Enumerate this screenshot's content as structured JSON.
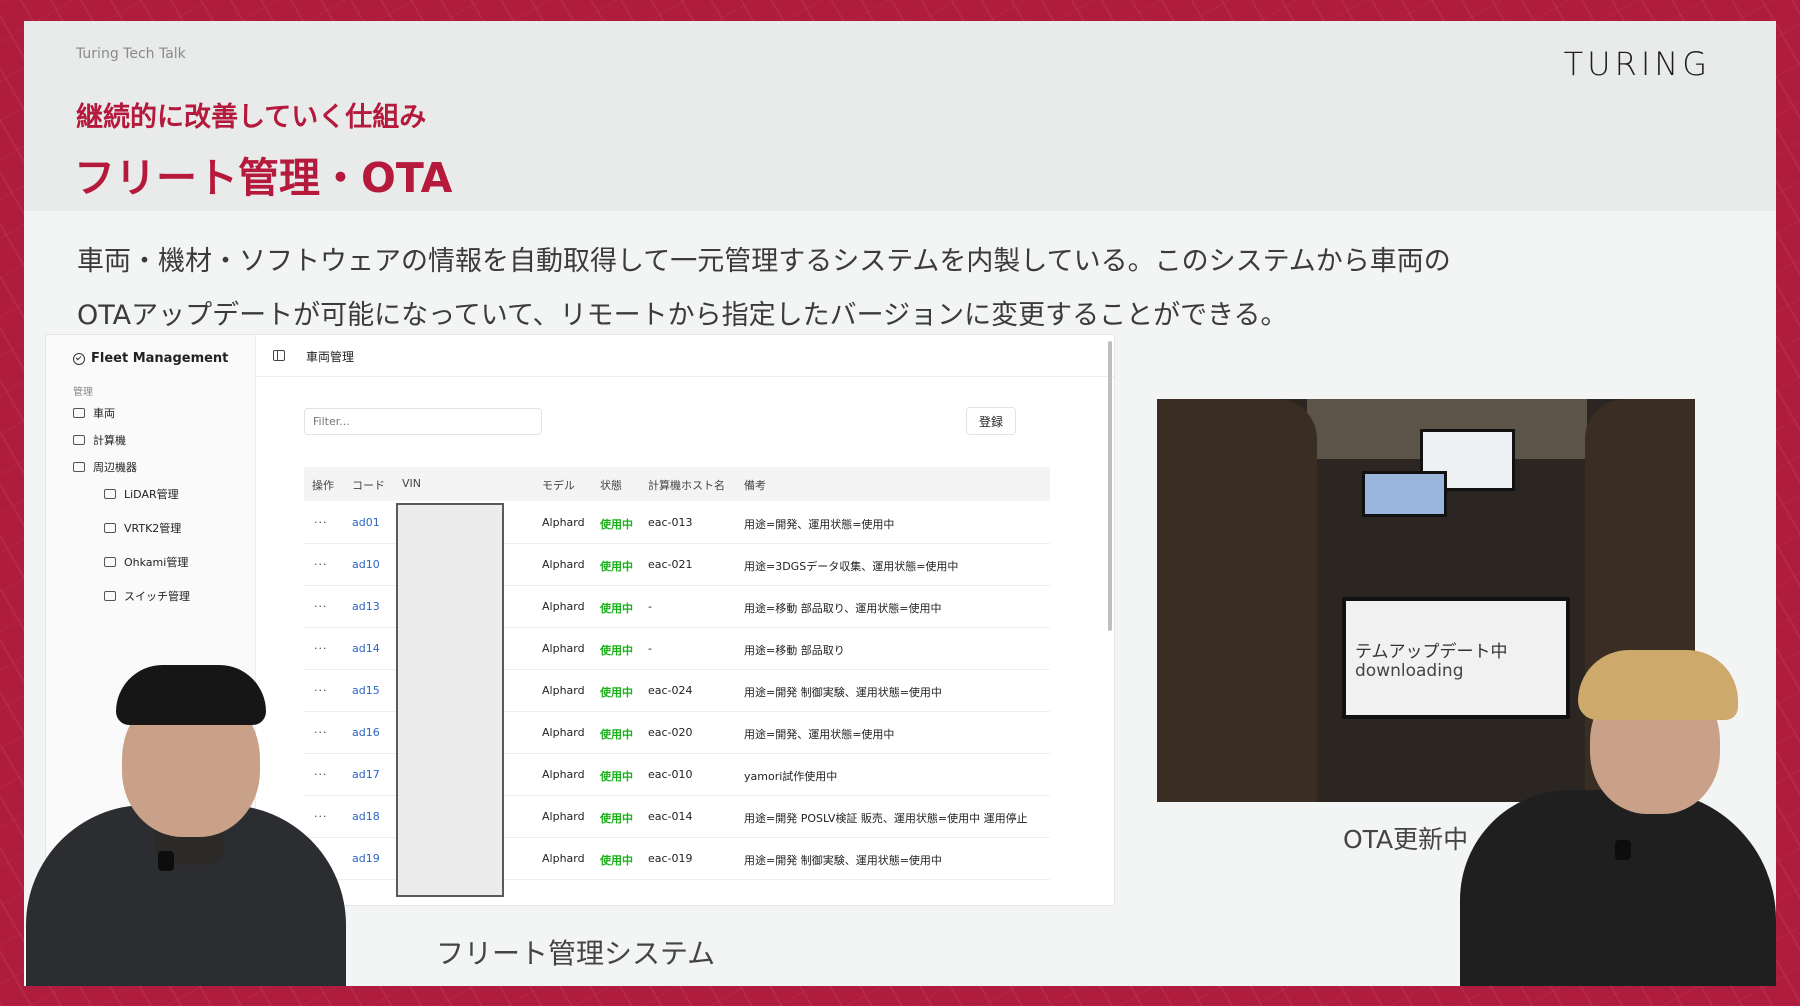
{
  "slide": {
    "event_name": "Turing Tech Talk",
    "logo": "TURING",
    "subtitle": "継続的に改善していく仕組み",
    "title": "フリート管理・OTA",
    "description_line1": "車両・機材・ソフトウェアの情報を自動取得して一元管理するシステムを内製している。このシステムから車両の",
    "description_line2": "OTAアップデートが可能になっていて、リモートから指定したバージョンに変更することができる。"
  },
  "fleet_app": {
    "brand": "Fleet Management",
    "group_label": "管理",
    "nav": [
      {
        "label": "車両",
        "icon": "car-icon"
      },
      {
        "label": "計算機",
        "icon": "server-icon"
      },
      {
        "label": "周辺機器",
        "icon": "devices-icon"
      },
      {
        "label": "LiDAR管理",
        "icon": "lidar-icon"
      },
      {
        "label": "VRTK2管理",
        "icon": "gnss-icon"
      },
      {
        "label": "Ohkami管理",
        "icon": "device-icon"
      },
      {
        "label": "スイッチ管理",
        "icon": "network-icon"
      }
    ],
    "breadcrumb": "車両管理",
    "filter_placeholder": "Filter...",
    "register_label": "登録",
    "columns": [
      "操作",
      "コード",
      "VIN",
      "モデル",
      "状態",
      "計算機ホスト名",
      "備考"
    ],
    "rows": [
      {
        "op": "···",
        "code": "ad01",
        "model": "Alphard",
        "status": "使用中",
        "host": "eac-013",
        "note": "用途=開発、運用状態=使用中"
      },
      {
        "op": "···",
        "code": "ad10",
        "model": "Alphard",
        "status": "使用中",
        "host": "eac-021",
        "note": "用途=3DGSデータ収集、運用状態=使用中"
      },
      {
        "op": "···",
        "code": "ad13",
        "model": "Alphard",
        "status": "使用中",
        "host": "-",
        "note": "用途=移動 部品取り、運用状態=使用中"
      },
      {
        "op": "···",
        "code": "ad14",
        "model": "Alphard",
        "status": "使用中",
        "host": "-",
        "note": "用途=移動 部品取り"
      },
      {
        "op": "···",
        "code": "ad15",
        "model": "Alphard",
        "status": "使用中",
        "host": "eac-024",
        "note": "用途=開発 制御実験、運用状態=使用中"
      },
      {
        "op": "···",
        "code": "ad16",
        "model": "Alphard",
        "status": "使用中",
        "host": "eac-020",
        "note": "用途=開発、運用状態=使用中"
      },
      {
        "op": "···",
        "code": "ad17",
        "model": "Alphard",
        "status": "使用中",
        "host": "eac-010",
        "note": "yamori試作使用中"
      },
      {
        "op": "···",
        "code": "ad18",
        "model": "Alphard",
        "status": "使用中",
        "host": "eac-014",
        "note": "用途=開発 POSLV検証 販売、運用状態=使用中 運用停止"
      },
      {
        "op": "···",
        "code": "ad19",
        "model": "Alphard",
        "status": "使用中",
        "host": "eac-019",
        "note": "用途=開発 制御実験、運用状態=使用中"
      }
    ]
  },
  "photo": {
    "monitor_line1": "テムアップデート中",
    "monitor_line2": "downloading"
  },
  "captions": {
    "fleet": "フリート管理システム",
    "ota": "OTA更新中"
  },
  "colors": {
    "frame": "#b01c3e",
    "accent": "#b5193c",
    "status_green": "#19b019",
    "link_blue": "#2a64c6"
  }
}
